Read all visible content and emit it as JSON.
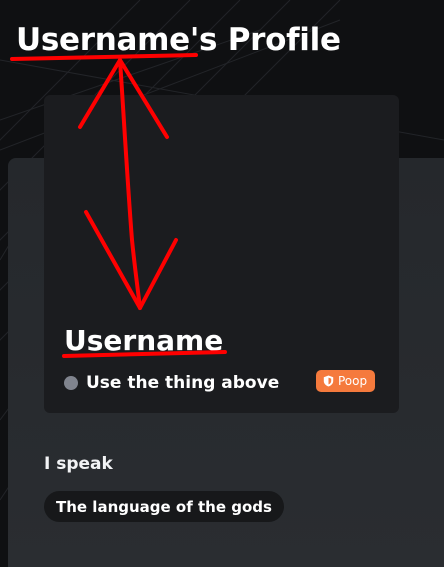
{
  "profile": {
    "title_name": "Username",
    "title_suffix": "'s Profile",
    "username": "Username",
    "status_text": "Use the thing above",
    "badge_label": "Poop",
    "badge_icon": "shield-icon"
  },
  "languages": {
    "heading": "I speak",
    "items": [
      "The language of the gods"
    ]
  },
  "colors": {
    "background": "#0f1012",
    "panel": "#26292d",
    "card": "#1b1c1f",
    "badge": "#f57a3d",
    "status_dot": "#80848e",
    "chip": "#17181a",
    "annotation": "#ff0000"
  }
}
